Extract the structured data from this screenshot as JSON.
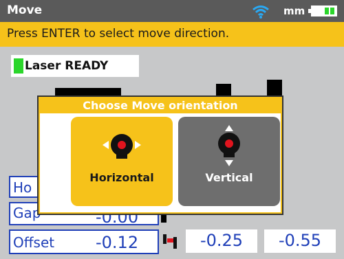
{
  "header": {
    "title": "Move",
    "units": "mm"
  },
  "prompt": "Press ENTER to select move direction.",
  "laser_status": "Laser READY",
  "fields": {
    "horizontal_short": "Ho",
    "gap_label": "Gap",
    "gap_value": "-0.00",
    "offset_label": "Offset",
    "offset_value": "-0.12"
  },
  "values": {
    "middle": "-0.25",
    "right": "-0.55"
  },
  "dialog": {
    "title": "Choose Move orientation",
    "options": [
      {
        "label": "Horizontal",
        "selected": true
      },
      {
        "label": "Vertical",
        "selected": false
      }
    ]
  },
  "colors": {
    "accent_yellow": "#f6c21a",
    "status_green": "#2bd62b",
    "value_blue": "#1f3fb8",
    "marker_red": "#e0141e"
  }
}
